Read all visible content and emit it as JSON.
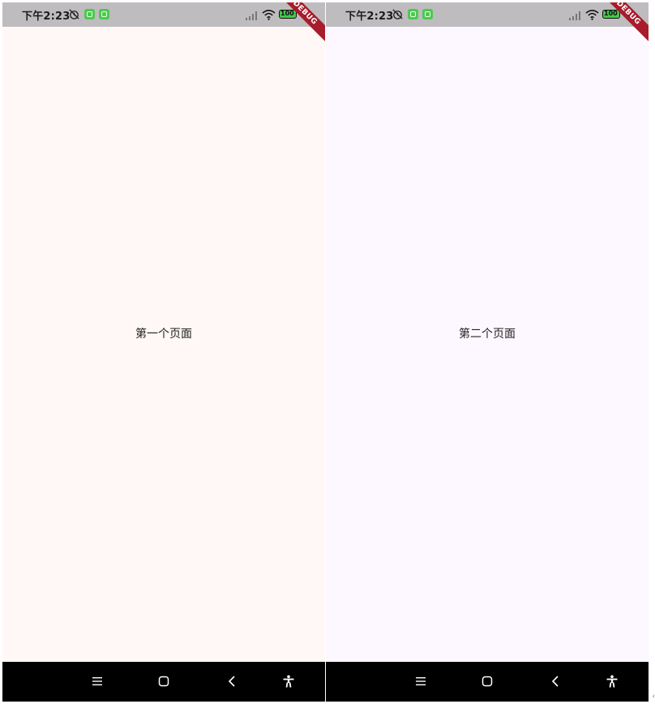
{
  "screens": [
    {
      "status_time": "下午2:23",
      "debug_label": "DEBUG",
      "battery_label": "100",
      "page_title": "第一个页面",
      "background": "#fff8f6"
    },
    {
      "status_time": "下午2:23",
      "debug_label": "DEBUG",
      "battery_label": "100",
      "page_title": "第二个页面",
      "background": "#fdf8ff"
    }
  ],
  "icons": {
    "status": [
      "alarm-off-icon",
      "app-notification-icon",
      "app-notification-icon",
      "signal-icon",
      "wifi-icon",
      "battery-icon"
    ],
    "navbar": [
      "menu-icon",
      "home-icon",
      "back-icon",
      "accessibility-icon"
    ]
  },
  "colors": {
    "status_bar": "#bfbcbf",
    "debug_banner": "#a81c2b",
    "nav_bar": "#000000",
    "app_badge": "#4cc94f"
  }
}
